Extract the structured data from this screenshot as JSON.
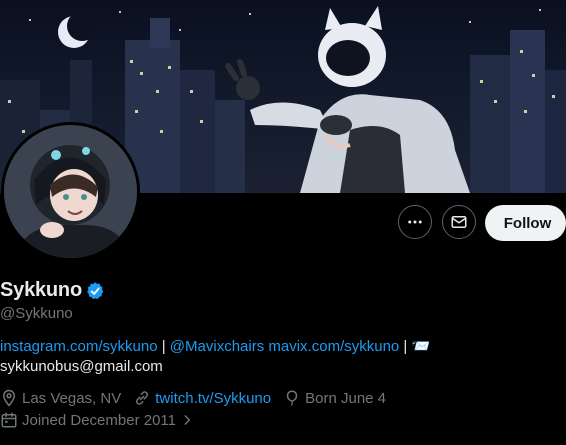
{
  "profile": {
    "display_name": "Sykkuno",
    "handle": "@Sykkuno",
    "verified": true
  },
  "actions": {
    "more_label": "More",
    "message_label": "Message",
    "follow_label": "Follow"
  },
  "bio": {
    "link1": "instagram.com/sykkuno",
    "sep1": " | ",
    "link2": "@Mavixchairs",
    "space": " ",
    "link3": "mavix.com/sykkuno",
    "sep2": " | ",
    "emoji": "📨",
    "email": "sykkunobus@gmail.com"
  },
  "meta": {
    "location": "Las Vegas, NV",
    "website": "twitch.tv/Sykkuno",
    "birthday": "Born June 4",
    "joined": "Joined December 2011"
  },
  "icons": {
    "more": "more-icon",
    "message": "mail-icon",
    "verified": "verified-badge-icon",
    "location": "location-icon",
    "link": "link-icon",
    "birthday": "balloon-icon",
    "calendar": "calendar-icon"
  },
  "colors": {
    "link": "#1d9bf0",
    "muted": "#71767b",
    "text": "#e7e9ea",
    "background": "#000000",
    "follow_bg": "#eff3f4"
  }
}
